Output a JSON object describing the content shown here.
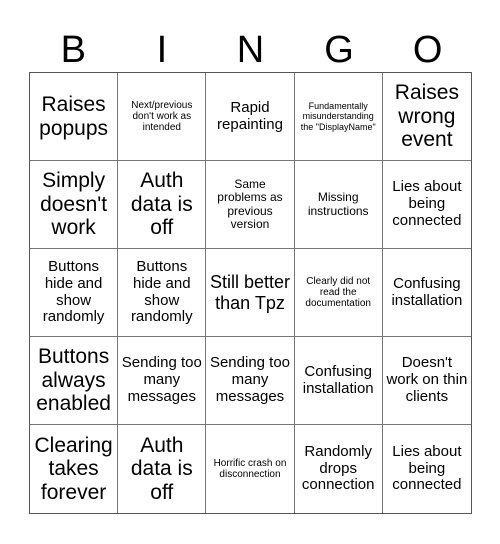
{
  "header": {
    "letters": [
      "B",
      "I",
      "N",
      "G",
      "O"
    ]
  },
  "cells": [
    [
      "Raises popups",
      "Next/previous don't work as intended",
      "Rapid repainting",
      "Fundamentally misunderstanding the \"DisplayName\"",
      "Raises wrong event"
    ],
    [
      "Simply doesn't work",
      "Auth data is off",
      "Same problems as previous version",
      "Missing instructions",
      "Lies about being connected"
    ],
    [
      "Buttons hide and show randomly",
      "Buttons hide and show randomly",
      "Still better than Tpz",
      "Clearly did not read the documentation",
      "Confusing installation"
    ],
    [
      "Buttons always enabled",
      "Sending too many messages",
      "Sending too many messages",
      "Confusing installation",
      "Doesn't work on thin clients"
    ],
    [
      "Clearing takes forever",
      "Auth data is off",
      "Horrific crash on disconnection",
      "Randomly drops connection",
      "Lies about being connected"
    ]
  ]
}
